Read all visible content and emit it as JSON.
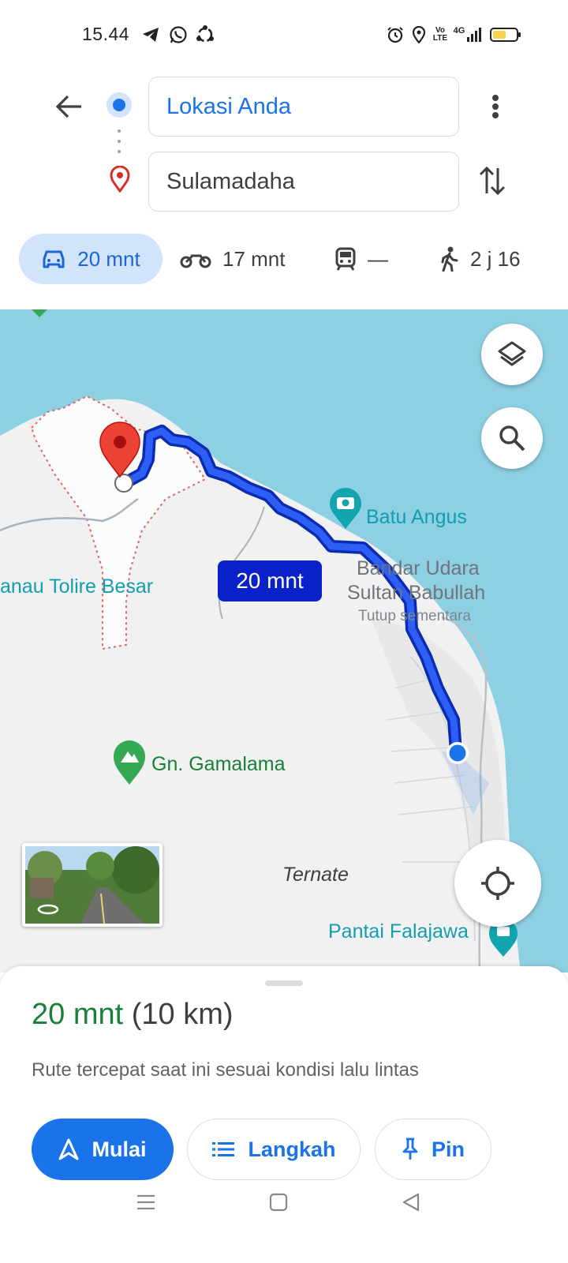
{
  "status_bar": {
    "time": "15.44",
    "left_icons": [
      "telegram-icon",
      "whatsapp-icon",
      "sync-app-icon"
    ],
    "right_icons": [
      "alarm-icon",
      "location-icon",
      "volte-icon",
      "4g-signal-icon",
      "battery-icon"
    ],
    "network_label": "4G"
  },
  "header": {
    "origin": {
      "value": "Lokasi Anda"
    },
    "destination": {
      "value": "Sulamadaha"
    }
  },
  "modes": [
    {
      "name": "car",
      "label": "20 mnt",
      "selected": true
    },
    {
      "name": "motorcycle",
      "label": "17 mnt",
      "selected": false
    },
    {
      "name": "transit",
      "label": "—",
      "selected": false
    },
    {
      "name": "walk",
      "label": "2 j 16",
      "selected": false
    }
  ],
  "map": {
    "route_badge": "20 mnt",
    "labels": {
      "batu_angus": "Batu Angus",
      "airport_line1": "Bandar Udara",
      "airport_line2": "Sultan Babullah",
      "airport_status": "Tutup sementara",
      "danau": "anau Tolire Besar",
      "gamalama": "Gn. Gamalama",
      "ternate": "Ternate",
      "falajawa": "Pantai Falajawa"
    },
    "colors": {
      "water": "#8ed0e3",
      "land": "#f1f1f1",
      "route": "#1a4ff5",
      "route_outline": "#0b2bb0",
      "badge": "#0b22c8",
      "poi_teal": "#12a5b0",
      "park_green": "#34a853",
      "destination_pin": "#ea4335"
    }
  },
  "sheet": {
    "duration": "20 mnt",
    "distance": "(10 km)",
    "description": "Rute tercepat saat ini sesuai kondisi lalu lintas",
    "start_label": "Mulai",
    "steps_label": "Langkah",
    "pin_label": "Pin"
  }
}
